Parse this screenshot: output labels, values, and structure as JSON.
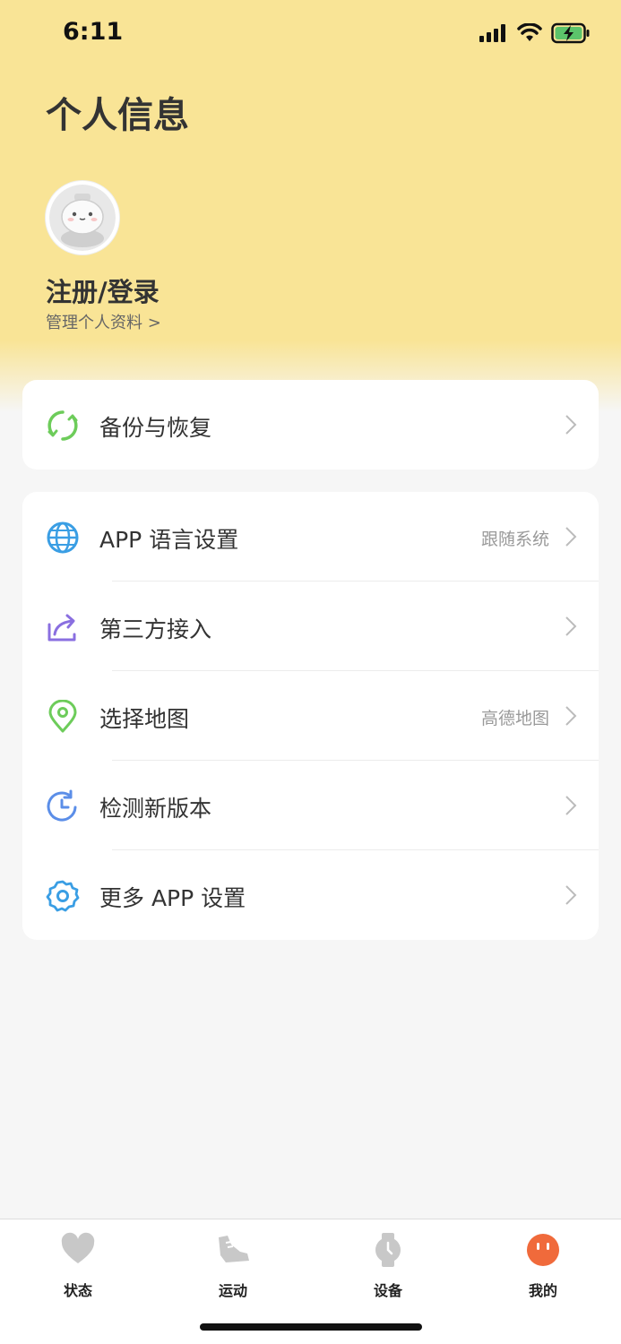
{
  "status_bar": {
    "time": "6:11"
  },
  "header": {
    "title": "个人信息",
    "user_name": "注册/登录",
    "user_subtitle": "管理个人资料 >"
  },
  "card1": {
    "items": [
      {
        "label": "备份与恢复",
        "icon": "sync-icon",
        "color": "#6dcc5a"
      }
    ]
  },
  "card2": {
    "items": [
      {
        "label": "APP 语言设置",
        "value": "跟随系统",
        "icon": "globe-icon",
        "color": "#3a9ee4"
      },
      {
        "label": "第三方接入",
        "value": "",
        "icon": "share-icon",
        "color": "#8a6fe0"
      },
      {
        "label": "选择地图",
        "value": "高德地图",
        "icon": "location-pin-icon",
        "color": "#6dcc5a"
      },
      {
        "label": "检测新版本",
        "value": "",
        "icon": "clock-refresh-icon",
        "color": "#5b8ee8"
      },
      {
        "label": "更多 APP 设置",
        "value": "",
        "icon": "gear-icon",
        "color": "#3a9ee4"
      }
    ]
  },
  "tabbar": {
    "tabs": [
      {
        "label": "状态",
        "icon": "heart-icon",
        "active": false
      },
      {
        "label": "运动",
        "icon": "shoe-icon",
        "active": false
      },
      {
        "label": "设备",
        "icon": "watch-icon",
        "active": false
      },
      {
        "label": "我的",
        "icon": "profile-face-icon",
        "active": true
      }
    ],
    "active_color": "#f06a3b",
    "inactive_color": "#c8c8c8"
  }
}
